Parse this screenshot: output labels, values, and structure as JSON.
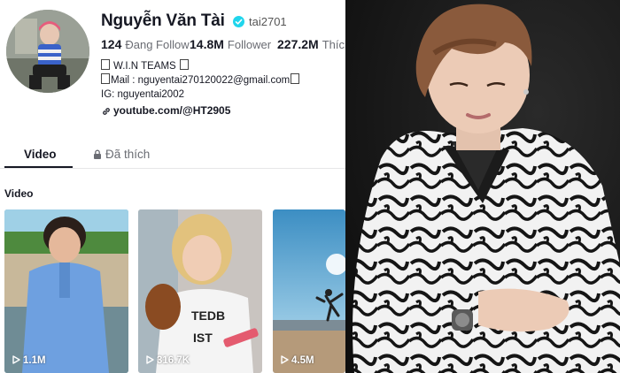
{
  "profile": {
    "name": "Nguyễn Văn Tài",
    "handle": "tai2701",
    "stats": {
      "following_count": "124",
      "following_label": "Đang Follow",
      "followers_count": "14.8M",
      "followers_label": "Follower",
      "likes_count": "227.2M",
      "likes_label": "Thích"
    },
    "bio": {
      "line1": "W.I.N TEAMS",
      "line2": "Mail : nguyentai270120022@gmail.com",
      "line3": "IG: nguyentai2002"
    },
    "link": "youtube.com/@HT2905"
  },
  "tabs": {
    "video": "Video",
    "liked": "Đã thích"
  },
  "section_title": "Video",
  "videos": [
    {
      "views": "1.1M"
    },
    {
      "views": "316.7K"
    },
    {
      "views": "4.5M"
    }
  ],
  "colors": {
    "verified": "#20d5ec",
    "text_primary": "#161823",
    "text_secondary": "#6a6c73"
  }
}
